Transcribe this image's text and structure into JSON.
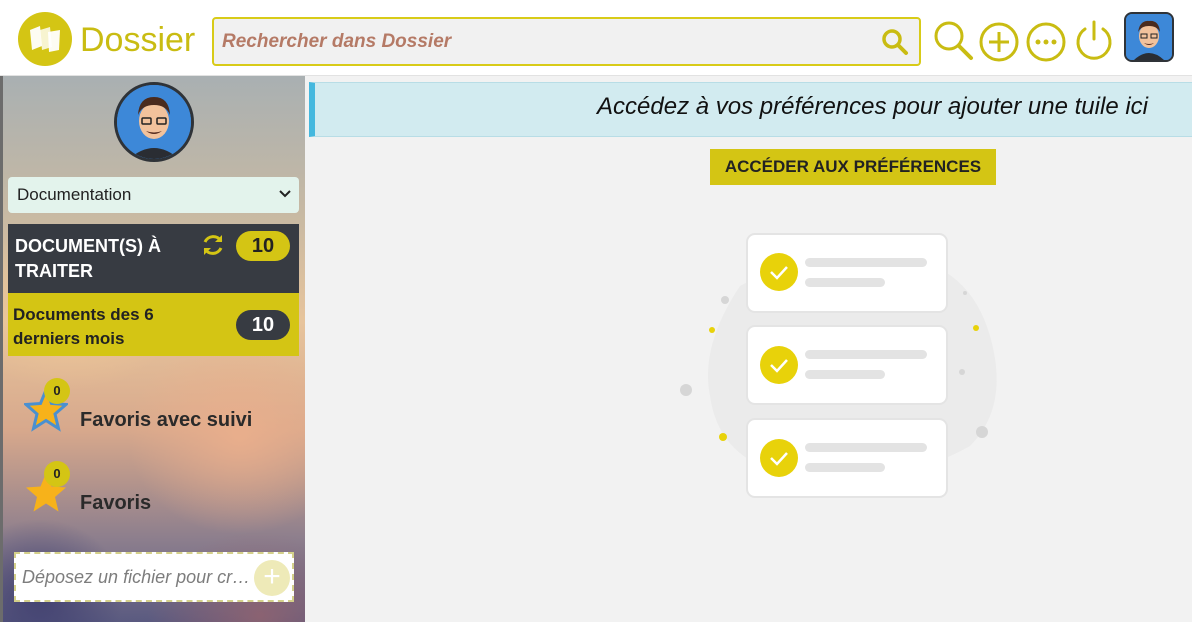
{
  "header": {
    "brand": "Dossier",
    "search_placeholder": "Rechercher dans Dossier"
  },
  "sidebar": {
    "select_value": "Documentation",
    "todo": {
      "title": "DOCUMENT(S) À TRAITER",
      "count": "10"
    },
    "recent": {
      "title": "Documents des 6 derniers mois",
      "count": "10"
    },
    "favorites": [
      {
        "label": "Favoris avec suivi",
        "count": "0"
      },
      {
        "label": "Favoris",
        "count": "0"
      }
    ],
    "dropzone_placeholder": "Déposez un fichier pour cr…"
  },
  "main": {
    "banner_text": "Accédez à vos préférences pour ajouter une tuile ici",
    "prefs_button": "ACCÉDER AUX PRÉFÉRENCES"
  },
  "colors": {
    "accent": "#d4c514",
    "dark": "#373b42",
    "banner": "#d2ebf0"
  }
}
